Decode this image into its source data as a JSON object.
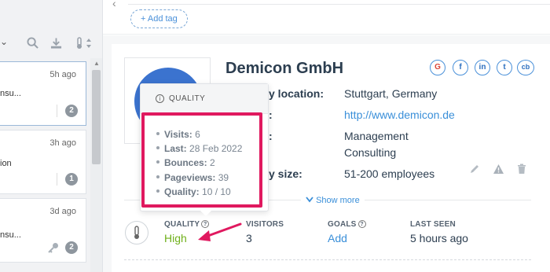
{
  "list": {
    "cards": [
      {
        "time": "5h ago",
        "snippet": "nsu...",
        "badge": "2"
      },
      {
        "time": "3h ago",
        "snippet": "ion",
        "badge": "1"
      },
      {
        "time": "3d ago",
        "snippet": "nsu...",
        "badge": "2"
      }
    ]
  },
  "header": {
    "add_tag_label": "+ Add tag"
  },
  "company": {
    "name": "Demicon GmbH",
    "socials": [
      "G",
      "f",
      "in",
      "t",
      "cb"
    ],
    "fields": [
      {
        "label": "y location:",
        "value": "Stuttgart, Germany"
      },
      {
        "label": ":",
        "value": "http://www.demicon.de"
      },
      {
        "label": ":",
        "value": "Management Consulting",
        "value_line1": "Management",
        "value_line2": "Consulting"
      },
      {
        "label": "y size:",
        "value": "51-200 employees"
      }
    ],
    "show_more": "Show more"
  },
  "stats": {
    "quality_label": "QUALITY",
    "quality_value": "High",
    "visitors_label": "VISITORS",
    "visitors_value": "3",
    "goals_label": "GOALS",
    "goals_value": "Add",
    "last_seen_label": "LAST SEEN",
    "last_seen_value": "5 hours ago"
  },
  "popover": {
    "title": "QUALITY",
    "items": [
      {
        "key": "Visits:",
        "value": "6"
      },
      {
        "key": "Last:",
        "value": "28 Feb 2022"
      },
      {
        "key": "Bounces:",
        "value": "2"
      },
      {
        "key": "Pageviews:",
        "value": "39"
      },
      {
        "key": "Quality:",
        "value": "10 / 10"
      }
    ]
  },
  "colors": {
    "accent": "#3a8fd9",
    "highlight": "#e0195f",
    "quality_green": "#6fb01a"
  }
}
